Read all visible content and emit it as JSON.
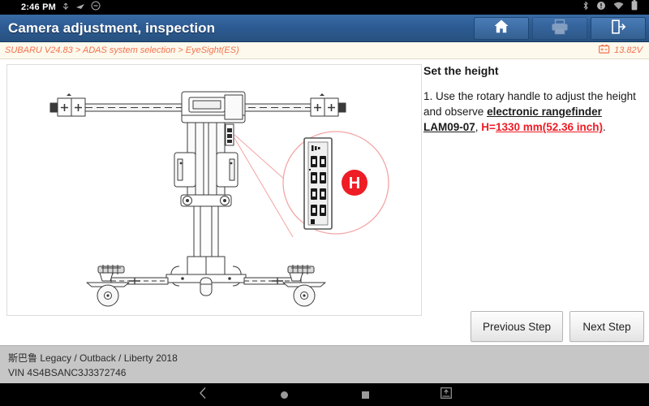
{
  "statusbar": {
    "clock": "2:46 PM",
    "left_icons": [
      "usb-icon",
      "vpn-key-icon",
      "do-not-disturb-icon"
    ],
    "right_icons": [
      "bluetooth-icon",
      "alert-circle-icon",
      "wifi-icon",
      "battery-icon"
    ]
  },
  "titlebar": {
    "title": "Camera adjustment, inspection",
    "buttons": [
      {
        "name": "home-button",
        "icon": "home-icon",
        "enabled": true
      },
      {
        "name": "print-button",
        "icon": "printer-icon",
        "enabled": false
      },
      {
        "name": "exit-button",
        "icon": "exit-icon",
        "enabled": true
      }
    ]
  },
  "breadcrumb": {
    "path": "SUBARU V24.83 > ADAS system selection > EyeSight(ES)",
    "voltage": "13.82V",
    "battery_icon": "battery-voltage-icon"
  },
  "instructions": {
    "heading": "Set the height",
    "step_number": "1. ",
    "text_1": "Use the rotary handle to adjust the height and observe ",
    "device": "electronic rangefinder LAM09-07",
    "comma": ", ",
    "label_h": "H=",
    "value": "1330 mm(52.36 inch)",
    "period": "."
  },
  "buttons": {
    "previous": "Previous Step",
    "next": "Next Step"
  },
  "illustration": {
    "alt": "ADAS calibration frame side view with magnified rangefinder display callout",
    "callout_badge": "H",
    "badge_color": "#ee1c25",
    "callout_outline_color": "#f3a4a4",
    "line_color": "#3a3a3a"
  },
  "vehicle": {
    "model": "斯巴鲁 Legacy / Outback / Liberty 2018",
    "vin": "VIN 4S4BSANC3J3372746"
  },
  "navbar": {
    "items": [
      {
        "name": "nav-back-button",
        "icon": "chevron-left-icon"
      },
      {
        "name": "nav-home-button",
        "icon": "circle-icon"
      },
      {
        "name": "nav-recents-button",
        "icon": "square-icon"
      },
      {
        "name": "nav-screenshot-button",
        "icon": "screenshot-icon"
      }
    ]
  },
  "colors": {
    "header_blue": "#2d5b93",
    "accent_orange": "#f2724e",
    "red": "#ee1c25",
    "footer_gray": "#c6c6c6"
  }
}
